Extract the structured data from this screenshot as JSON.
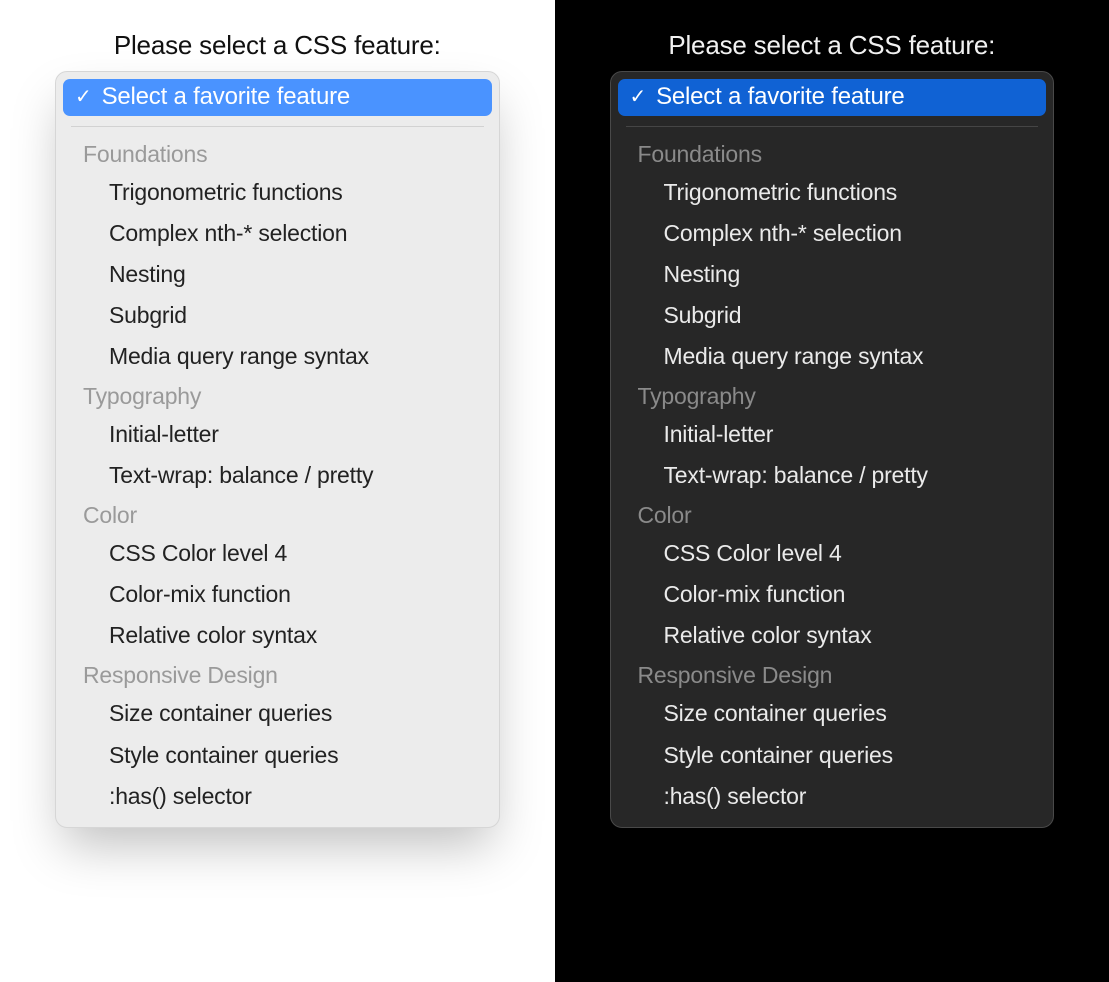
{
  "prompt": "Please select a CSS feature:",
  "selected_label": "Select a favorite feature",
  "colors": {
    "light_highlight": "#4a93ff",
    "dark_highlight": "#1062d4"
  },
  "groups": [
    {
      "label": "Foundations",
      "options": [
        "Trigonometric functions",
        "Complex nth-* selection",
        "Nesting",
        "Subgrid",
        "Media query range syntax"
      ]
    },
    {
      "label": "Typography",
      "options": [
        "Initial-letter",
        "Text-wrap: balance / pretty"
      ]
    },
    {
      "label": "Color",
      "options": [
        "CSS Color level 4",
        "Color-mix function",
        "Relative color syntax"
      ]
    },
    {
      "label": "Responsive Design",
      "options": [
        "Size container queries",
        "Style container queries",
        ":has() selector"
      ]
    }
  ]
}
